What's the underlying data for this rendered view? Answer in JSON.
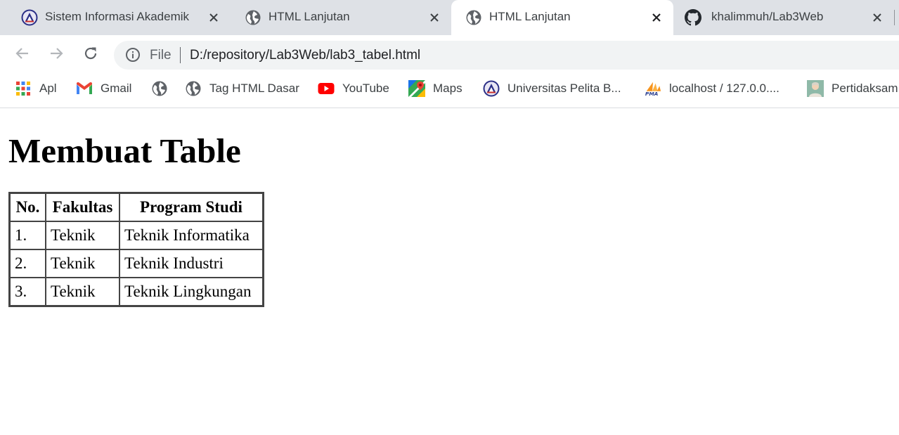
{
  "tabs": [
    {
      "title": "Sistem Informasi Akademik",
      "favicon": "university-logo-icon",
      "active": false
    },
    {
      "title": "HTML Lanjutan",
      "favicon": "globe-icon",
      "active": false
    },
    {
      "title": "HTML Lanjutan",
      "favicon": "globe-icon",
      "active": true
    },
    {
      "title": "khalimmuh/Lab3Web",
      "favicon": "github-icon",
      "active": false
    }
  ],
  "omnibox": {
    "scheme_label": "File",
    "url": "D:/repository/Lab3Web/lab3_tabel.html"
  },
  "bookmarks": [
    {
      "label": "Apl",
      "icon": "apps-grid-icon"
    },
    {
      "label": "Gmail",
      "icon": "gmail-icon"
    },
    {
      "label": "",
      "icon": "globe-icon"
    },
    {
      "label": "Tag HTML Dasar",
      "icon": "globe-icon"
    },
    {
      "label": "YouTube",
      "icon": "youtube-icon"
    },
    {
      "label": "Maps",
      "icon": "maps-icon"
    },
    {
      "label": "Universitas Pelita B...",
      "icon": "university-logo-icon"
    },
    {
      "label": "localhost / 127.0.0....",
      "icon": "phpmyadmin-icon"
    },
    {
      "label": "Pertidaksam",
      "icon": "person-thumbnail-icon"
    }
  ],
  "page": {
    "heading": "Membuat Table",
    "table": {
      "headers": [
        "No.",
        "Fakultas",
        "Program Studi"
      ],
      "rows": [
        [
          "1.",
          "Teknik",
          "Teknik Informatika"
        ],
        [
          "2.",
          "Teknik",
          "Teknik Industri"
        ],
        [
          "3.",
          "Teknik",
          "Teknik Lingkungan"
        ]
      ]
    }
  },
  "colors": {
    "tabstrip_bg": "#dee1e6",
    "omnibox_bg": "#f1f3f4",
    "youtube_red": "#ff0000"
  }
}
